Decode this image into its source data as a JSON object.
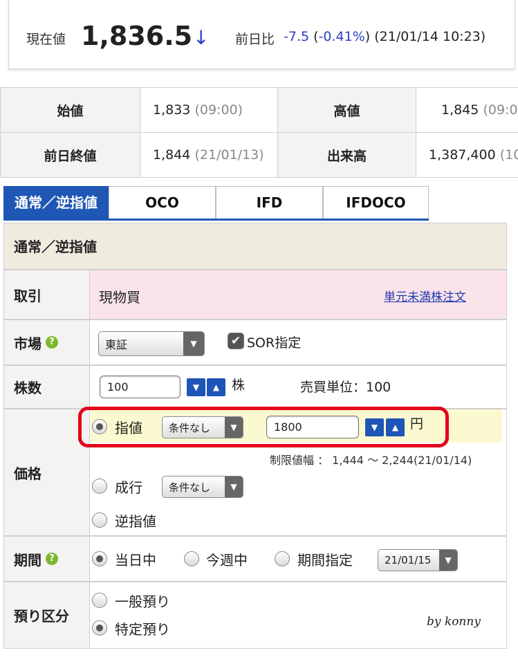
{
  "price": {
    "label": "現在値",
    "value": "1,836.5",
    "arrow": "↓",
    "change_label": "前日比",
    "change_value": "-7.5",
    "change_pct": "(-0.41%)",
    "datetime": "(21/01/14 10:23)",
    "change_color": "#2a3ec0"
  },
  "summary": {
    "open_label": "始値",
    "open_value": "1,833",
    "open_time": "(09:00)",
    "high_label": "高値",
    "high_value": "1,845",
    "high_time": "(09:04",
    "prev_close_label": "前日終値",
    "prev_close_value": "1,844",
    "prev_close_date": "(21/01/13)",
    "volume_label": "出来高",
    "volume_value": "1,387,400",
    "volume_extra": "(10"
  },
  "tabs": [
    "通常／逆指値",
    "OCO",
    "IFD",
    "IFDOCO"
  ],
  "form": {
    "header": "通常／逆指値",
    "trade": {
      "label": "取引",
      "value": "現物買",
      "link": "単元未満株注文"
    },
    "market": {
      "label": "市場",
      "select": "東証",
      "sor_label": "SOR指定",
      "help": "?"
    },
    "shares": {
      "label": "株数",
      "value": "100",
      "unit": "株",
      "lot_label": "売買単位：100"
    },
    "price": {
      "label": "価格",
      "limit_label": "指値",
      "limit_condition": "条件なし",
      "limit_value": "1800",
      "unit": "円",
      "range_text": "制限値幅 ： 1,444 〜 2,244(21/01/14)",
      "market_label": "成行",
      "market_condition": "条件なし",
      "stop_label": "逆指値"
    },
    "period": {
      "label": "期間",
      "help": "?",
      "today": "当日中",
      "this_week": "今週中",
      "specify": "期間指定",
      "date": "21/01/15"
    },
    "account": {
      "label": "預り区分",
      "general": "一般預り",
      "specific": "特定預り"
    }
  },
  "watermark": "by konny",
  "colors": {
    "accent": "#1f57b5",
    "highlight": "#e3061c",
    "trade_bg": "#fbe3ea",
    "price_row_bg": "#fbf9d0",
    "help": "#7cb82f"
  }
}
